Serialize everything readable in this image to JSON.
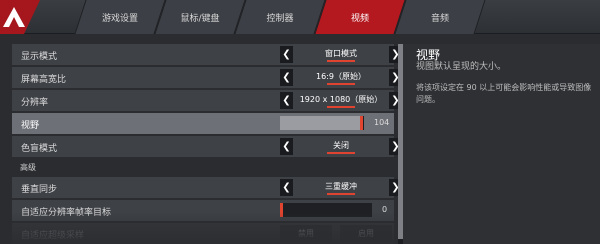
{
  "nav": {
    "tabs": [
      {
        "label": "游戏设置"
      },
      {
        "label": "鼠标/键盘"
      },
      {
        "label": "控制器"
      },
      {
        "label": "视频"
      },
      {
        "label": "音频"
      }
    ],
    "active_tab": "视频"
  },
  "settings": {
    "display_mode": {
      "label": "显示模式",
      "value": "窗口模式"
    },
    "aspect_ratio": {
      "label": "屏幕高宽比",
      "value": "16:9（原始）"
    },
    "resolution": {
      "label": "分辨率",
      "value": "1920 x 1080（原始）"
    },
    "fov": {
      "label": "视野",
      "value": "104",
      "fill_fraction": 0.97
    },
    "colorblind": {
      "label": "色盲模式",
      "value": "关闭"
    },
    "advanced_header": "高级",
    "vsync": {
      "label": "垂直同步",
      "value": "三重缓冲"
    },
    "adaptive_res": {
      "label": "自适应分辨率帧率目标",
      "value": "0",
      "fill_fraction": 0.0
    },
    "adaptive_supersampling": {
      "label": "自适应超级采样",
      "off_label": "禁用",
      "on_label": "启用"
    }
  },
  "description": {
    "title": "视野",
    "subtitle": "视图默认呈现的大小。",
    "body": "将该项设定在 90 以上可能会影响性能或导致图像问题。"
  },
  "colors": {
    "accent": "#b3191f",
    "marker": "#e2452f"
  }
}
